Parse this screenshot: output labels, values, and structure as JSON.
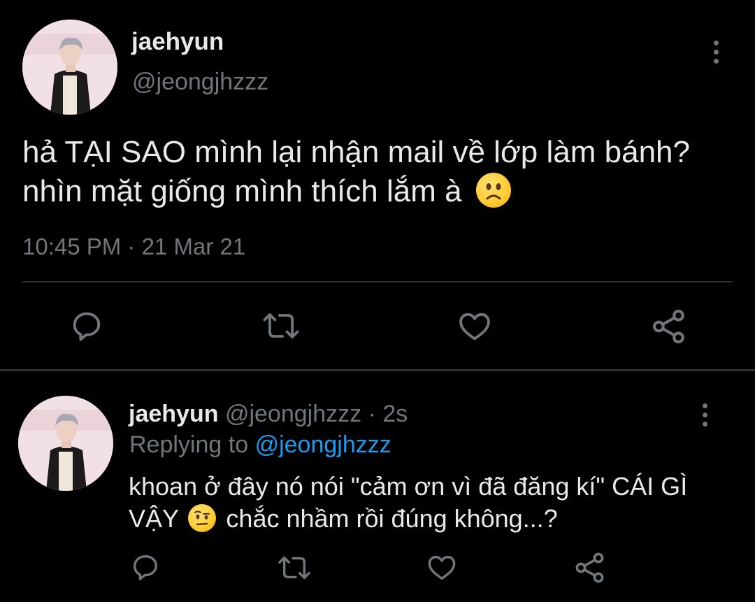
{
  "main_tweet": {
    "display_name": "jaehyun",
    "handle": "@jeongjhzzz",
    "text_line1": "hả TẠI SAO mình lại nhận mail về lớp làm bánh?",
    "text_line2": "nhìn mặt giống mình thích lắm à",
    "emoji_name": "frowning-face",
    "timestamp": "10:45 PM · 21 Mar 21"
  },
  "reply_tweet": {
    "display_name": "jaehyun",
    "handle": "@jeongjhzzz",
    "time": "· 2s",
    "replying_label": "Replying to",
    "replying_handle": "@jeongjhzzz",
    "text_line1": "khoan ở đây nó nói \"cảm ơn vì đã đăng kí\" CÁI GÌ",
    "text_line2_a": "VẬY",
    "text_line2_b": "chắc nhầm rồi đúng không...?",
    "emoji_name": "face-with-raised-eyebrow"
  },
  "actions": [
    "reply",
    "retweet",
    "like",
    "share"
  ],
  "colors": {
    "background": "#000000",
    "text": "#e7e9ea",
    "muted": "#71767b",
    "accent": "#1d9bf0"
  }
}
